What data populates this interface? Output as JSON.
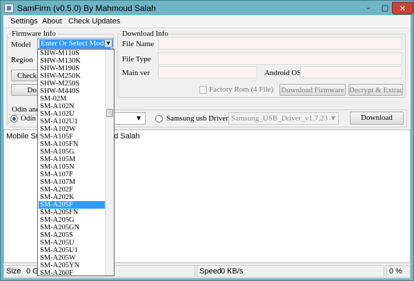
{
  "window": {
    "title": "SamFirm  (v0.5.0) By Mahmoud Salah",
    "minimize_glyph": "–",
    "maximize_glyph": "□",
    "close_glyph": "✕",
    "icons": {
      "app": "samfirm-app-icon",
      "dropdown": "chevron-down-icon"
    }
  },
  "menu": {
    "items": [
      "Settings",
      "About",
      "Check Updates"
    ]
  },
  "firmware_info": {
    "legend": "Firmware Info",
    "model_label": "Model",
    "region_label": "Region",
    "check_button_label": "Check U",
    "download_button_label": "Do"
  },
  "model_dropdown": {
    "value": "Enter Or Select Model",
    "arrow": "▼",
    "selected": "SM-A205F",
    "items": [
      "SHW-M110S",
      "SHW-M130K",
      "SHW-M190S",
      "SHW-M250K",
      "SHW-M250S",
      "SHW-M440S",
      "SM-02M",
      "SM-A102N",
      "SM-A102U",
      "SM-A102U1",
      "SM-A102W",
      "SM-A105F",
      "SM-A105FN",
      "SM-A105G",
      "SM-A105M",
      "SM-A105N",
      "SM-A107F",
      "SM-A107M",
      "SM-A202F",
      "SM-A202K",
      "SM-A205F",
      "SM-A205FN",
      "SM-A205G",
      "SM-A205GN",
      "SM-A205S",
      "SM-A205U",
      "SM-A205U1",
      "SM-A205W",
      "SM-A205YN",
      "SM-A260F"
    ]
  },
  "download_info": {
    "legend": "Download Info",
    "file_name_label": "File Name",
    "file_type_label": "File Type",
    "main_ver_label": "Main ver",
    "android_os_label": "Android OS",
    "factory_rom_label": "Factory Rom (4 File)",
    "download_firmware_label": "Download Firmware",
    "decrypt_extract_label": "Decrypt & Extract"
  },
  "odin_section": {
    "legend": "Odin and",
    "odin_radio_label": "Odin F",
    "usb_radio_label": "Samsung usb Drivers",
    "usb_driver_value": "Samsung_USB_Driver_v1.7.23",
    "download_label": "Download"
  },
  "log": {
    "left_text": "Mobile Sm",
    "right_text": "oud Salah"
  },
  "status": {
    "size_label": "Size",
    "size_value": "0 GB",
    "speed_label": "Speed",
    "speed_value": "0 KB/s",
    "percent": "0 %"
  }
}
